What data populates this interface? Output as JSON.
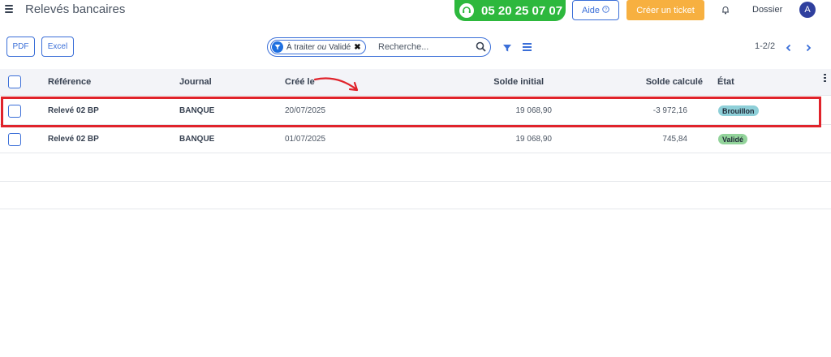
{
  "app": {
    "title": "Relevés bancaires",
    "phone": "05 20 25 07 07",
    "help_label": "Aide",
    "help_icon": "question-circle-icon",
    "ticket_label": "Créer un ticket",
    "dossier_label": "Dossier",
    "avatar_initial": "A"
  },
  "toolbar": {
    "pdf_label": "PDF",
    "excel_label": "Excel",
    "facet": {
      "value1": "À traiter",
      "separator": "ou",
      "value2": "Validé"
    },
    "search_placeholder": "Recherche...",
    "pager": "1-2/2"
  },
  "table": {
    "columns": [
      "Référence",
      "Journal",
      "Créé le",
      "Solde initial",
      "Solde calculé",
      "État"
    ],
    "rows": [
      {
        "reference": "Relevé 02 BP",
        "journal": "BANQUE",
        "created": "20/07/2025",
        "initial": "19 068,90",
        "computed": "-3 972,16",
        "state": "Brouillon",
        "state_color": "#8ecfd8"
      },
      {
        "reference": "Relevé 02 BP",
        "journal": "BANQUE",
        "created": "01/07/2025",
        "initial": "19 068,90",
        "computed": "745,84",
        "state": "Validé",
        "state_color": "#92d39a"
      }
    ]
  },
  "colors": {
    "accent": "#3b6fd8",
    "phone_bg": "#2db83d",
    "ticket_bg": "#f7b040",
    "highlight": "#e0232b"
  }
}
